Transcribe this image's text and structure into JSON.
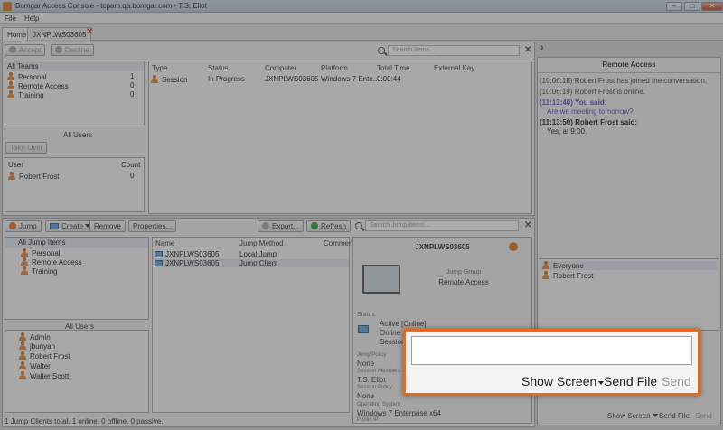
{
  "window": {
    "title": "Bomgar Access Console - tcpam.qa.bomgar.com - T.S. Eliot"
  },
  "menu": [
    "File",
    "Help"
  ],
  "tabs": {
    "home": "Home",
    "session": "JXNPLWS03605"
  },
  "queue": {
    "accept": "Accept",
    "decline": "Decline",
    "search_placeholder": "Search Items...",
    "teams_header": "All Teams",
    "teams": [
      {
        "name": "Personal",
        "count": "1"
      },
      {
        "name": "Remote Access",
        "count": "0"
      },
      {
        "name": "Training",
        "count": "0"
      }
    ],
    "all_users": "All Users",
    "take_over": "Take Over",
    "users_col_user": "User",
    "users_col_count": "Count",
    "users": [
      {
        "name": "Robert Frost",
        "count": "0"
      }
    ],
    "columns": [
      "Type",
      "Status",
      "Computer",
      "Platform",
      "Total Time",
      "External Key"
    ],
    "sessions": [
      {
        "type": "Session",
        "status": "In Progress",
        "computer": "JXNPLWS03605",
        "platform": "Windows 7 Ente...",
        "total_time": "0:00:44",
        "key": ""
      }
    ]
  },
  "jump": {
    "jump_btn": "Jump",
    "create_btn": "Create",
    "remove_btn": "Remove",
    "properties_btn": "Properties...",
    "export_btn": "Export...",
    "refresh_btn": "Refresh",
    "search_placeholder": "Search Jump Items...",
    "groups_header": "All Jump Items",
    "groups": [
      "Personal",
      "Remote Access",
      "Training"
    ],
    "all_users": "All Users",
    "users": [
      "Admin",
      "jbunyan",
      "Robert Frost",
      "Walter",
      "Walter Scott"
    ],
    "columns": [
      "Name",
      "Jump Method",
      "Comment"
    ],
    "items": [
      {
        "name": "JXNPLWS03605",
        "method": "Local Jump"
      },
      {
        "name": "JXNPLWS03605",
        "method": "Jump Client"
      }
    ],
    "footer": "1 Jump Clients total.   1 online.   0 offline.   0 passive."
  },
  "details": {
    "title": "JXNPLWS03605",
    "jump_group_label": "Jump Group",
    "jump_group": "Remote Access",
    "status_label": "Status",
    "status_lines": [
      "Active [Online]",
      "Online Since: 2016-03-... ",
      "Session st..."
    ],
    "jump_policy_label": "Jump Policy",
    "jump_policy": "None",
    "session_members_label": "Session Members",
    "session_members": "T.S. Eliot",
    "session_policy_label": "Session Policy",
    "session_policy": "None",
    "os_label": "Operating System",
    "os": "Windows 7 Enterprise x64",
    "public_ip_label": "Public IP"
  },
  "chat": {
    "header": "Remote Access",
    "messages": [
      {
        "text": "(10:06:18) Robert Frost has joined the conversation.",
        "style": "system"
      },
      {
        "text": "(10:06:19) Robert Frost is online.",
        "style": "system"
      },
      {
        "text": "(11:13:40) You said:",
        "style": "you-head"
      },
      {
        "text": "Are we meeting tomorrow?",
        "style": "you-body"
      },
      {
        "text": "(11:13:50) Robert Frost said:",
        "style": "other-head"
      },
      {
        "text": "Yes, at 9:00.",
        "style": "other-body"
      }
    ],
    "recipients": [
      "Everyone",
      "Robert Frost"
    ],
    "show_screen": "Show Screen",
    "send_file": "Send File",
    "send": "Send"
  },
  "callout": {
    "show_screen": "Show Screen",
    "send_file": "Send File",
    "send": "Send",
    "input_value": ""
  },
  "colors": {
    "accent": "#e66a1a",
    "chat_you": "#5a4fc0",
    "link_blue": "#5b66c8"
  }
}
